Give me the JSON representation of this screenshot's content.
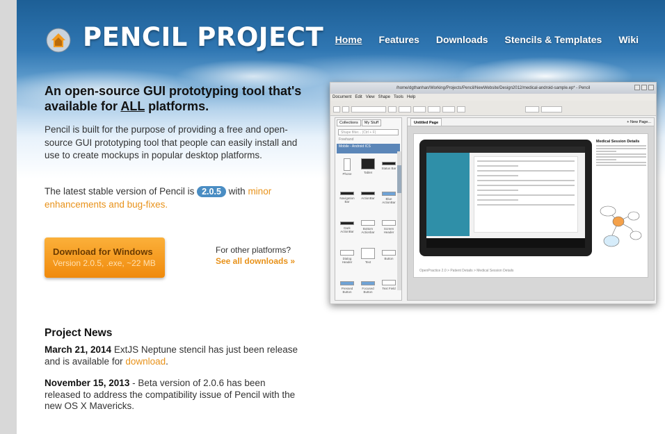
{
  "brand": {
    "name": "PENCIL PROJECT",
    "logo_icon": "pencil-house-icon"
  },
  "nav": {
    "items": [
      {
        "label": "Home",
        "active": true
      },
      {
        "label": "Features",
        "active": false
      },
      {
        "label": "Downloads",
        "active": false
      },
      {
        "label": "Stencils & Templates",
        "active": false
      },
      {
        "label": "Wiki",
        "active": false
      }
    ]
  },
  "hero": {
    "tagline_part1": "An open-source GUI prototyping tool that's available for ",
    "tagline_emph": "ALL",
    "tagline_part2": " platforms.",
    "description": "Pencil is built for the purpose of providing a free and open-source GUI prototyping tool that people can easily install and use to create mockups in popular desktop platforms.",
    "stable_prefix": "The latest stable version of Pencil is ",
    "stable_version": "2.0.5",
    "stable_mid": " with ",
    "stable_link": "minor enhancements and bug-fixes."
  },
  "download": {
    "button_title": "Download for Windows",
    "button_subtitle": "Version 2.0.5, .exe, ~22 MB",
    "other_prefix": "For other platforms?",
    "other_link": "See all downloads »"
  },
  "news": {
    "heading": "Project News",
    "items": [
      {
        "date": "March 21, 2014",
        "text_before": " ExtJS Neptune stencil has just been release and is available for ",
        "link": "download",
        "text_after": "."
      },
      {
        "date": "November 15, 2013",
        "text_before": " - Beta version of 2.0.6 has been released to address the compatibility issue of Pencil with the new OS X Mavericks.",
        "link": "",
        "text_after": ""
      }
    ]
  },
  "screenshot": {
    "window_title": "/home/dgthanhan/Working/Projects/Pencil/NewWebsite/Design2012/medical-android-sample.ep* - Pencil",
    "menu": [
      "Document",
      "Edit",
      "View",
      "Shape",
      "Tools",
      "Help"
    ],
    "sidebar_tabs": [
      "Collections",
      "My Stuff"
    ],
    "search_placeholder": "Shape filter... (Ctrl + F)",
    "section_freehand": "Freehand",
    "section_android": "Mobile - Android ICS",
    "shapes": [
      "Phone",
      "Tablet",
      "Status Bar",
      "Navigation Bar",
      "ActionBar",
      "Blue ActionBar",
      "Dark ActionBar",
      "Bottom Actionbar",
      "Screen Header",
      "Dialog Header",
      "Text",
      "Button",
      "Pressed Button",
      "Focused Button",
      "Text Field"
    ],
    "page_tab": "Untitled Page",
    "new_page": "+ New Page...",
    "notes_title": "Medical Session Details",
    "breadcrumb": "OpenPractice 2.0 > Patient Details > Medical Session Details"
  }
}
